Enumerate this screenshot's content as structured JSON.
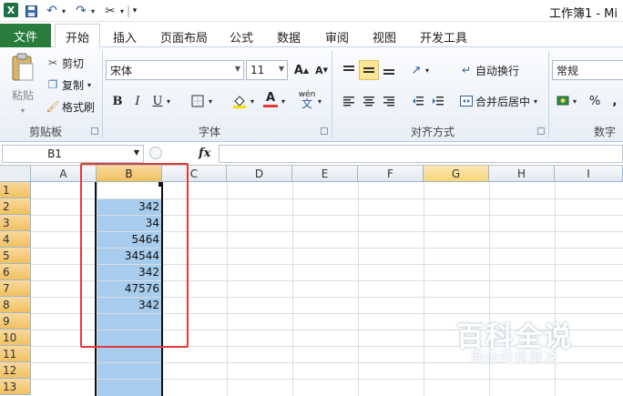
{
  "titlebar": {
    "window_title": "工作簿1 - Mi",
    "qat_separator": "|",
    "qat_more": "▾"
  },
  "tabs": {
    "file": "文件",
    "items": [
      "开始",
      "插入",
      "页面布局",
      "公式",
      "数据",
      "审阅",
      "视图",
      "开发工具"
    ]
  },
  "ribbon": {
    "clipboard": {
      "paste": "粘贴",
      "cut": "剪切",
      "copy": "复制",
      "format_painter": "格式刷",
      "label": "剪贴板"
    },
    "font": {
      "font_name": "宋体",
      "font_size": "11",
      "bold": "B",
      "italic": "I",
      "underline": "U",
      "label": "字体",
      "accent_color": "#e03b3b"
    },
    "alignment": {
      "wrap_text": "自动换行",
      "merge_center": "合并后居中",
      "label": "对齐方式"
    },
    "number": {
      "format": "常规",
      "percent": "%",
      "label": "数字"
    }
  },
  "formula_bar": {
    "name_box": "B1",
    "fx": "fx",
    "formula": ""
  },
  "sheet": {
    "columns": [
      "A",
      "B",
      "C",
      "D",
      "E",
      "F",
      "G",
      "H",
      "I"
    ],
    "rows": [
      "1",
      "2",
      "3",
      "4",
      "5",
      "6",
      "7",
      "8",
      "9",
      "10",
      "11",
      "12",
      "13"
    ],
    "column_b_values": [
      "",
      "342",
      "34",
      "5464",
      "34544",
      "342",
      "47576",
      "342",
      "",
      "",
      "",
      "",
      ""
    ],
    "selected_column": "B",
    "active_cell": "B1",
    "selection_color": "#a7ccee",
    "highlight_box_color": "#e03b3b"
  },
  "watermark": {
    "title": "百科全说",
    "subtitle": "助你轻松解决"
  }
}
